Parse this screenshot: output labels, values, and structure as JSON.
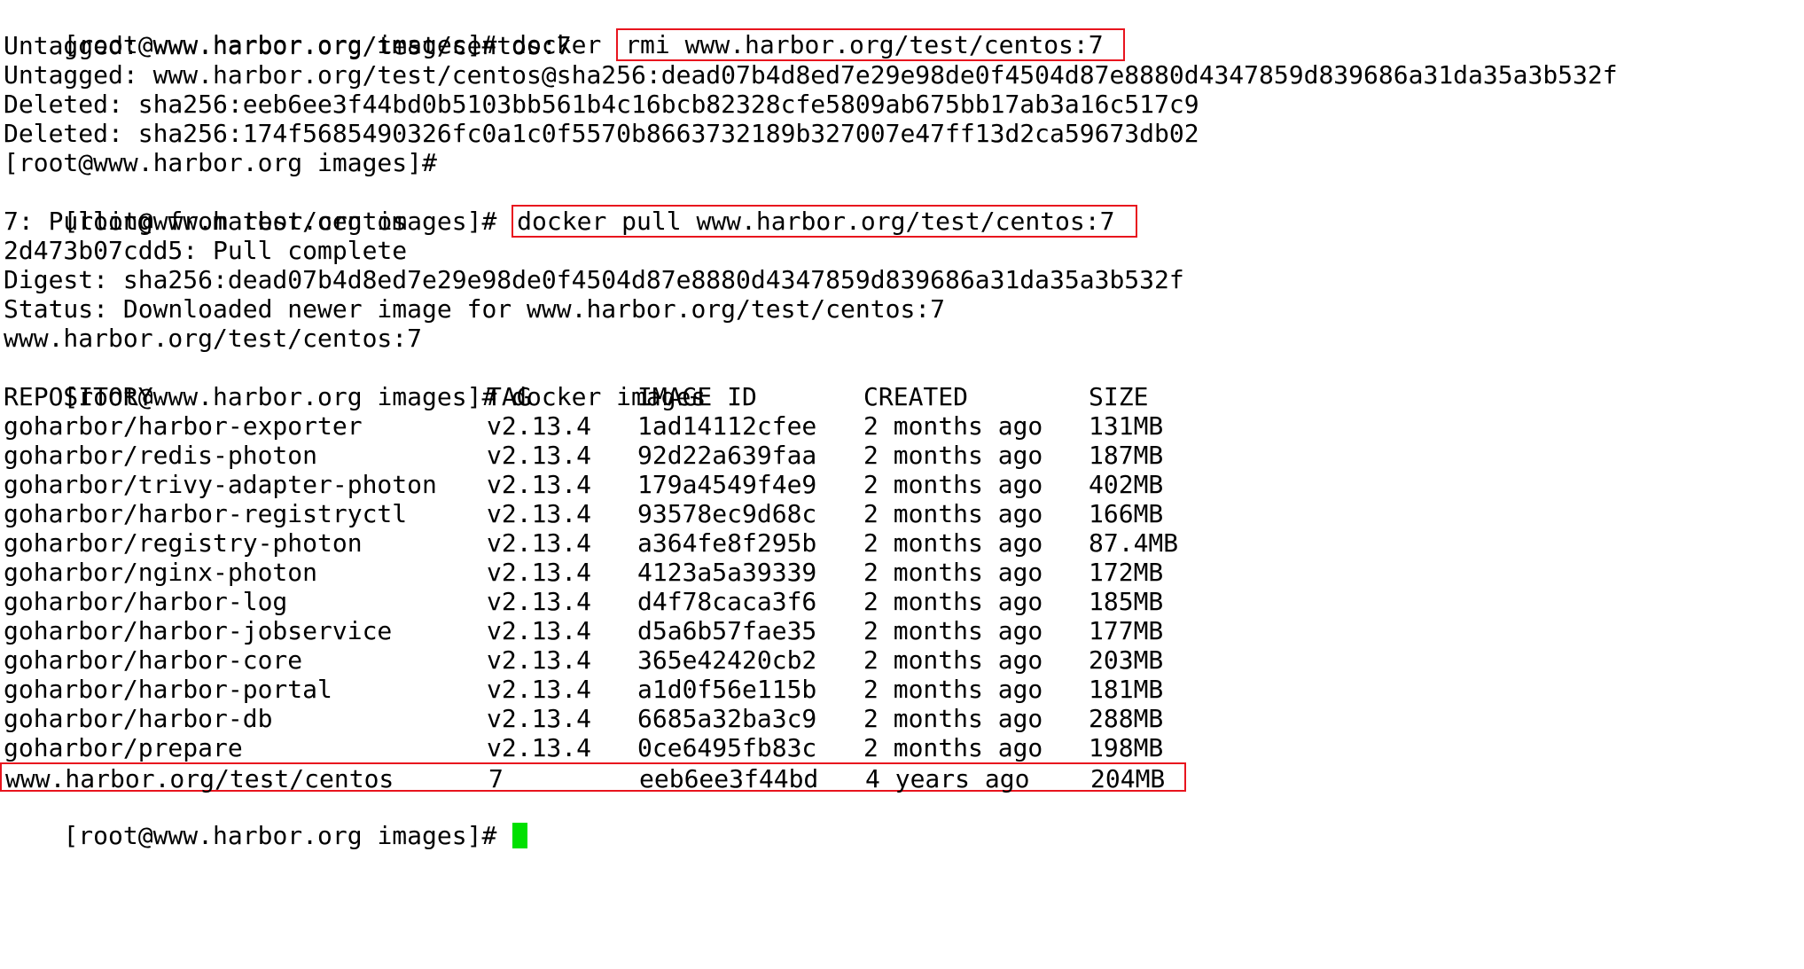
{
  "terminal": {
    "prompt": "[root@www.harbor.org images]# ",
    "block1": {
      "cmd_prefix": "docker ",
      "cmd_highlight": "rmi www.harbor.org/test/centos:7",
      "output": [
        "Untagged: www.harbor.org/test/centos:7",
        "Untagged: www.harbor.org/test/centos@sha256:dead07b4d8ed7e29e98de0f4504d87e8880d4347859d839686a31da35a3b532f",
        "Deleted: sha256:eeb6ee3f44bd0b5103bb561b4c16bcb82328cfe5809ab675bb17ab3a16c517c9",
        "Deleted: sha256:174f5685490326fc0a1c0f5570b8663732189b327007e47ff13d2ca59673db02"
      ]
    },
    "empty_prompt": "[root@www.harbor.org images]#",
    "block2": {
      "cmd_highlight": "docker pull www.harbor.org/test/centos:7",
      "output": [
        "7: Pulling from test/centos",
        "2d473b07cdd5: Pull complete",
        "Digest: sha256:dead07b4d8ed7e29e98de0f4504d87e8880d4347859d839686a31da35a3b532f",
        "Status: Downloaded newer image for www.harbor.org/test/centos:7",
        "www.harbor.org/test/centos:7"
      ]
    },
    "block3": {
      "cmd": "docker images",
      "headers": {
        "repository": "REPOSITORY",
        "tag": "TAG",
        "image_id": "IMAGE ID",
        "created": "CREATED",
        "size": "SIZE"
      },
      "rows": [
        {
          "repository": "goharbor/harbor-exporter",
          "tag": "v2.13.4",
          "image_id": "1ad14112cfee",
          "created": "2 months ago",
          "size": "131MB"
        },
        {
          "repository": "goharbor/redis-photon",
          "tag": "v2.13.4",
          "image_id": "92d22a639faa",
          "created": "2 months ago",
          "size": "187MB"
        },
        {
          "repository": "goharbor/trivy-adapter-photon",
          "tag": "v2.13.4",
          "image_id": "179a4549f4e9",
          "created": "2 months ago",
          "size": "402MB"
        },
        {
          "repository": "goharbor/harbor-registryctl",
          "tag": "v2.13.4",
          "image_id": "93578ec9d68c",
          "created": "2 months ago",
          "size": "166MB"
        },
        {
          "repository": "goharbor/registry-photon",
          "tag": "v2.13.4",
          "image_id": "a364fe8f295b",
          "created": "2 months ago",
          "size": "87.4MB"
        },
        {
          "repository": "goharbor/nginx-photon",
          "tag": "v2.13.4",
          "image_id": "4123a5a39339",
          "created": "2 months ago",
          "size": "172MB"
        },
        {
          "repository": "goharbor/harbor-log",
          "tag": "v2.13.4",
          "image_id": "d4f78caca3f6",
          "created": "2 months ago",
          "size": "185MB"
        },
        {
          "repository": "goharbor/harbor-jobservice",
          "tag": "v2.13.4",
          "image_id": "d5a6b57fae35",
          "created": "2 months ago",
          "size": "177MB"
        },
        {
          "repository": "goharbor/harbor-core",
          "tag": "v2.13.4",
          "image_id": "365e42420cb2",
          "created": "2 months ago",
          "size": "203MB"
        },
        {
          "repository": "goharbor/harbor-portal",
          "tag": "v2.13.4",
          "image_id": "a1d0f56e115b",
          "created": "2 months ago",
          "size": "181MB"
        },
        {
          "repository": "goharbor/harbor-db",
          "tag": "v2.13.4",
          "image_id": "6685a32ba3c9",
          "created": "2 months ago",
          "size": "288MB"
        },
        {
          "repository": "goharbor/prepare",
          "tag": "v2.13.4",
          "image_id": "0ce6495fb83c",
          "created": "2 months ago",
          "size": "198MB"
        },
        {
          "repository": "www.harbor.org/test/centos",
          "tag": "7",
          "image_id": "eeb6ee3f44bd",
          "created": "4 years ago",
          "size": "204MB"
        }
      ]
    },
    "final_prompt": "[root@www.harbor.org images]# ",
    "colors": {
      "background": "#ffffff",
      "text": "#000000",
      "highlight_border": "#e8141e",
      "cursor": "#00e000"
    }
  }
}
